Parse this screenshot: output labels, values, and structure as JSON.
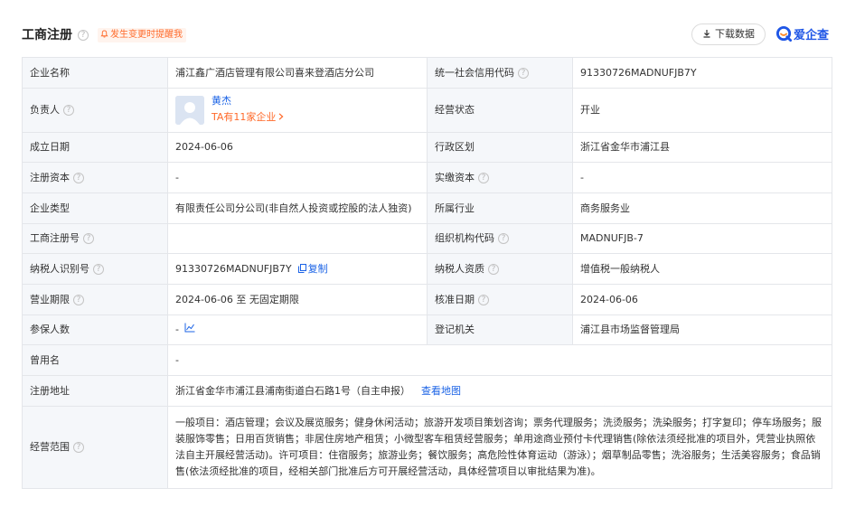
{
  "header": {
    "title": "工商注册",
    "alert_text": "发生变更时提醒我",
    "download_label": "下载数据",
    "brand_name": "爱企查",
    "icons": {
      "help": "question-circle-icon",
      "alert": "bell-icon",
      "download": "download-arrow-icon",
      "brand": "brand-logo-icon"
    }
  },
  "help_glyph": "?",
  "colors": {
    "accent_blue": "#1b63e6",
    "accent_orange": "#ff6a2a",
    "label_bg": "#f5f7fa",
    "border": "#e4e6ea"
  },
  "info": {
    "company_name": {
      "label": "企业名称",
      "value": "浦江鑫广酒店管理有限公司喜来登酒店分公司"
    },
    "credit_code": {
      "label": "统一社会信用代码",
      "value": "91330726MADNUFJB7Y"
    },
    "legal_person": {
      "label": "负责人",
      "name": "黄杰",
      "companies": "TA有11家企业"
    },
    "status": {
      "label": "经营状态",
      "value": "开业"
    },
    "founded": {
      "label": "成立日期",
      "value": "2024-06-06"
    },
    "region": {
      "label": "行政区划",
      "value": "浙江省金华市浦江县"
    },
    "reg_capital": {
      "label": "注册资本",
      "value": "-"
    },
    "paid_capital": {
      "label": "实缴资本",
      "value": "-"
    },
    "company_type": {
      "label": "企业类型",
      "value": "有限责任公司分公司(非自然人投资或控股的法人独资)"
    },
    "industry": {
      "label": "所属行业",
      "value": "商务服务业"
    },
    "reg_no": {
      "label": "工商注册号",
      "value": ""
    },
    "org_code": {
      "label": "组织机构代码",
      "value": "MADNUFJB-7"
    },
    "taxpayer_id": {
      "label": "纳税人识别号",
      "value": "91330726MADNUFJB7Y",
      "copy_label": "复制"
    },
    "taxpayer_type": {
      "label": "纳税人资质",
      "value": "增值税一般纳税人"
    },
    "business_term": {
      "label": "营业期限",
      "value": "2024-06-06 至 无固定期限"
    },
    "approval_date": {
      "label": "核准日期",
      "value": "2024-06-06"
    },
    "insured": {
      "label": "参保人数",
      "value": "-"
    },
    "authority": {
      "label": "登记机关",
      "value": "浦江县市场监督管理局"
    },
    "former_name": {
      "label": "曾用名",
      "value": "-"
    },
    "address": {
      "label": "注册地址",
      "value": "浙江省金华市浦江县浦南街道白石路1号（自主申报）",
      "map_label": "查看地图"
    },
    "scope": {
      "label": "经营范围",
      "value": "一般项目：酒店管理；会议及展览服务；健身休闲活动；旅游开发项目策划咨询；票务代理服务；洗烫服务；洗染服务；打字复印；停车场服务；服装服饰零售；日用百货销售；非居住房地产租赁；小微型客车租赁经营服务；单用途商业预付卡代理销售(除依法须经批准的项目外，凭营业执照依法自主开展经营活动)。许可项目：住宿服务；旅游业务；餐饮服务；高危险性体育运动（游泳）；烟草制品零售；洗浴服务；生活美容服务；食品销售(依法须经批准的项目，经相关部门批准后方可开展经营活动，具体经营项目以审批结果为准)。"
    }
  }
}
